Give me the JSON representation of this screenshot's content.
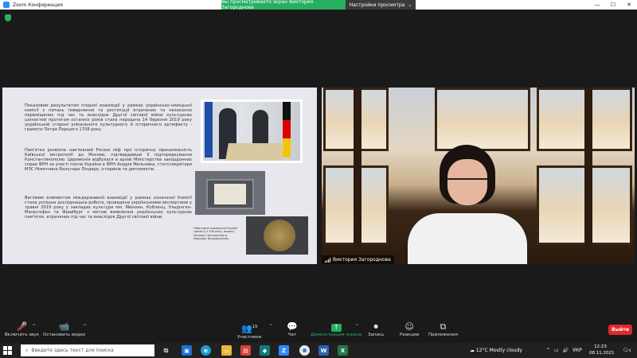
{
  "window": {
    "title": "Zoom Конференция",
    "share_banner": "Вы просматриваете экран Виктория Загороднова",
    "view_options": "Настройки просмотра",
    "view_options_caret": "⌄",
    "controls": [
      "—",
      "☐",
      "✕"
    ]
  },
  "slide": {
    "paragraph1": "Показовим результатом плідної взаємодії у рамках українсько-німецької комісії з питань повернення та реституції втрачених та незаконно переміщених під час та внаслідок Другої світової війни культурних цінностей протягом останніх років стала передача 14 березня 2019 року українській стороні унікального культурного й історичного артефакту - грамоти Петра Першого 1708 року.",
    "paragraph2": "Пам'ятка розвіяла нав'язаний Росією міф про історичну приналежність Київської метрополії до Москви, підтвердивши її підпорядкування Константинополю. Церемонія відбулася в архіві Міністерства закордонних справ ФРН за участі посла України в ФРН Андрія Мельника, статссекретаря МЗС Німеччини Вальтера Ліндера, істориків та дипломатів.",
    "paragraph3": "Вагомим елементом міждержавної взаємодії у рамках означеної Комісії стала успішна дослідницька робота, проведена українськими експертами у травні 2019 року у закладах культури мм. Мюнхен, Кобленц, Ульдінген-Мюльгофен та Фрайбург з метою виявлення українських культурних пам'яток, втрачених під час та внаслідок Другої світової війни.",
    "caption": "Німеччина повернула Україні грамоту 1708 року, видану Петром І митрополиту Йоасафу Кроковському"
  },
  "participant": {
    "name": "Виктория Загороднова"
  },
  "toolbar": {
    "mic_label": "Включить звук",
    "video_label": "Остановить видео",
    "participants_label": "Участники",
    "participants_count": "19",
    "chat_label": "Чат",
    "share_label": "Демонстрация экрана",
    "record_label": "Запись",
    "reactions_label": "Реакции",
    "apps_label": "Приложения",
    "leave_label": "Выйти",
    "accent": "#27ae60",
    "leave_color": "#e0282e"
  },
  "taskbar": {
    "search_placeholder": "Введите здесь текст для поиска",
    "weather": "12°C  Mostly cloudy",
    "language": "УКР",
    "time": "12:23",
    "date": "08.11.2021",
    "notification_count": "4"
  }
}
